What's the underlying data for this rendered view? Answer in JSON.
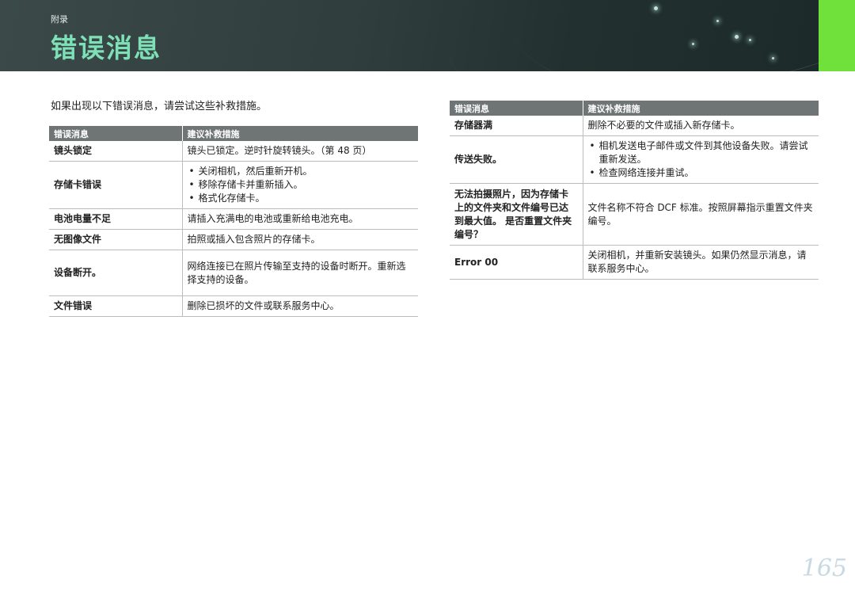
{
  "header": {
    "section_label": "附录",
    "title": "错误消息"
  },
  "intro": "如果出现以下错误消息，请尝试这些补救措施。",
  "table_headers": {
    "message": "错误消息",
    "remedy": "建议补救措施"
  },
  "left_table": [
    {
      "message": "镜头锁定",
      "remedy": "镜头已锁定。逆时针旋转镜头。（第 48 页）"
    },
    {
      "message": "存储卡错误",
      "remedy_list": [
        "关闭相机，然后重新开机。",
        "移除存储卡并重新插入。",
        "格式化存储卡。"
      ]
    },
    {
      "message": "电池电量不足",
      "remedy": "请插入充满电的电池或重新给电池充电。"
    },
    {
      "message": "无图像文件",
      "remedy": "拍照或插入包含照片的存储卡。"
    },
    {
      "message": "设备断开。",
      "remedy": "网络连接已在照片传输至支持的设备时断开。重新选择支持的设备。"
    },
    {
      "message": "文件错误",
      "remedy": "删除已损坏的文件或联系服务中心。"
    }
  ],
  "right_table": [
    {
      "message": "存储器满",
      "remedy": "删除不必要的文件或插入新存储卡。"
    },
    {
      "message": "传送失败。",
      "remedy_list": [
        "相机发送电子邮件或文件到其他设备失败。请尝试重新发送。",
        "检查网络连接并重试。"
      ]
    },
    {
      "message": "无法拍摄照片，因为存储卡上的文件夹和文件编号已达到最大值。 是否重置文件夹编号？",
      "remedy": "文件名称不符合 DCF 标准。按照屏幕指示重置文件夹编号。"
    },
    {
      "message": "Error 00",
      "remedy": "关闭相机，并重新安装镜头。如果仍然显示消息，请联系服务中心。"
    }
  ],
  "page_number": "165",
  "colors": {
    "title": "#7ee0b7",
    "accent_tab": "#6fe13a",
    "table_header": "#6f7475"
  }
}
